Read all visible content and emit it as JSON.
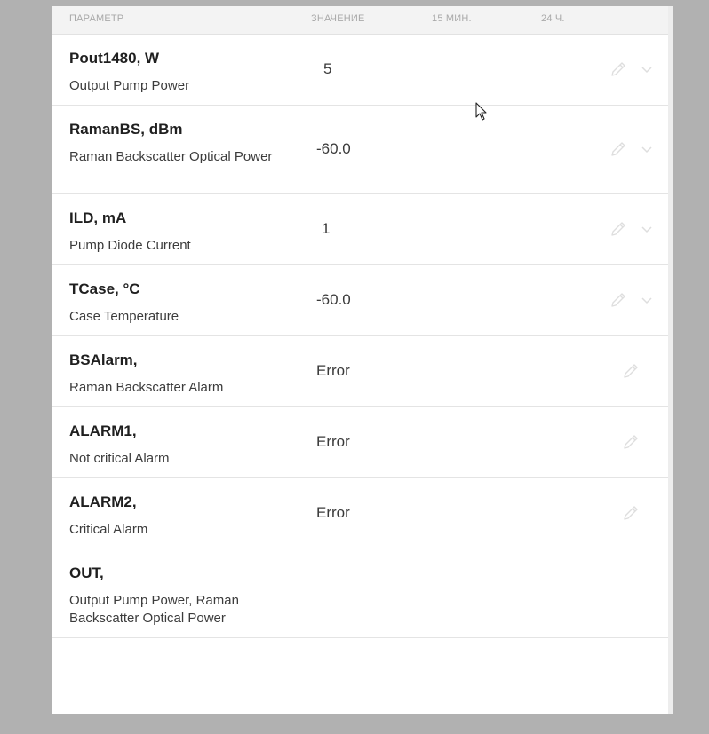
{
  "table": {
    "headers": {
      "param": "ПАРАМЕТР",
      "value": "ЗНАЧЕНИЕ",
      "min15": "15 МИН.",
      "h24": "24 Ч."
    },
    "rows": [
      {
        "name": "Pout1480, W",
        "desc": "Output Pump Power",
        "value": "5"
      },
      {
        "name": "RamanBS, dBm",
        "desc": "Raman Backscatter Optical Power",
        "value": "-60.0"
      },
      {
        "name": "ILD, mA",
        "desc": "Pump Diode Current",
        "value": "1"
      },
      {
        "name": "TCase, °C",
        "desc": "Case Temperature",
        "value": "-60.0"
      },
      {
        "name": "BSAlarm,",
        "desc": "Raman Backscatter Alarm",
        "value": "Error"
      },
      {
        "name": "ALARM1,",
        "desc": "Not critical Alarm",
        "value": "Error"
      },
      {
        "name": "ALARM2,",
        "desc": "Critical Alarm",
        "value": "Error"
      },
      {
        "name": "OUT,",
        "desc": "Output Pump Power, Raman Backscatter Optical Power",
        "value": ""
      }
    ]
  },
  "icons": {
    "edit": "pencil-icon",
    "expand": "chevron-down-icon",
    "cursor": "mouse-pointer-icon"
  },
  "colors": {
    "background": "#b1b1b1",
    "panel": "#ffffff",
    "header_bg": "#f3f3f3",
    "icon": "#dedede"
  }
}
